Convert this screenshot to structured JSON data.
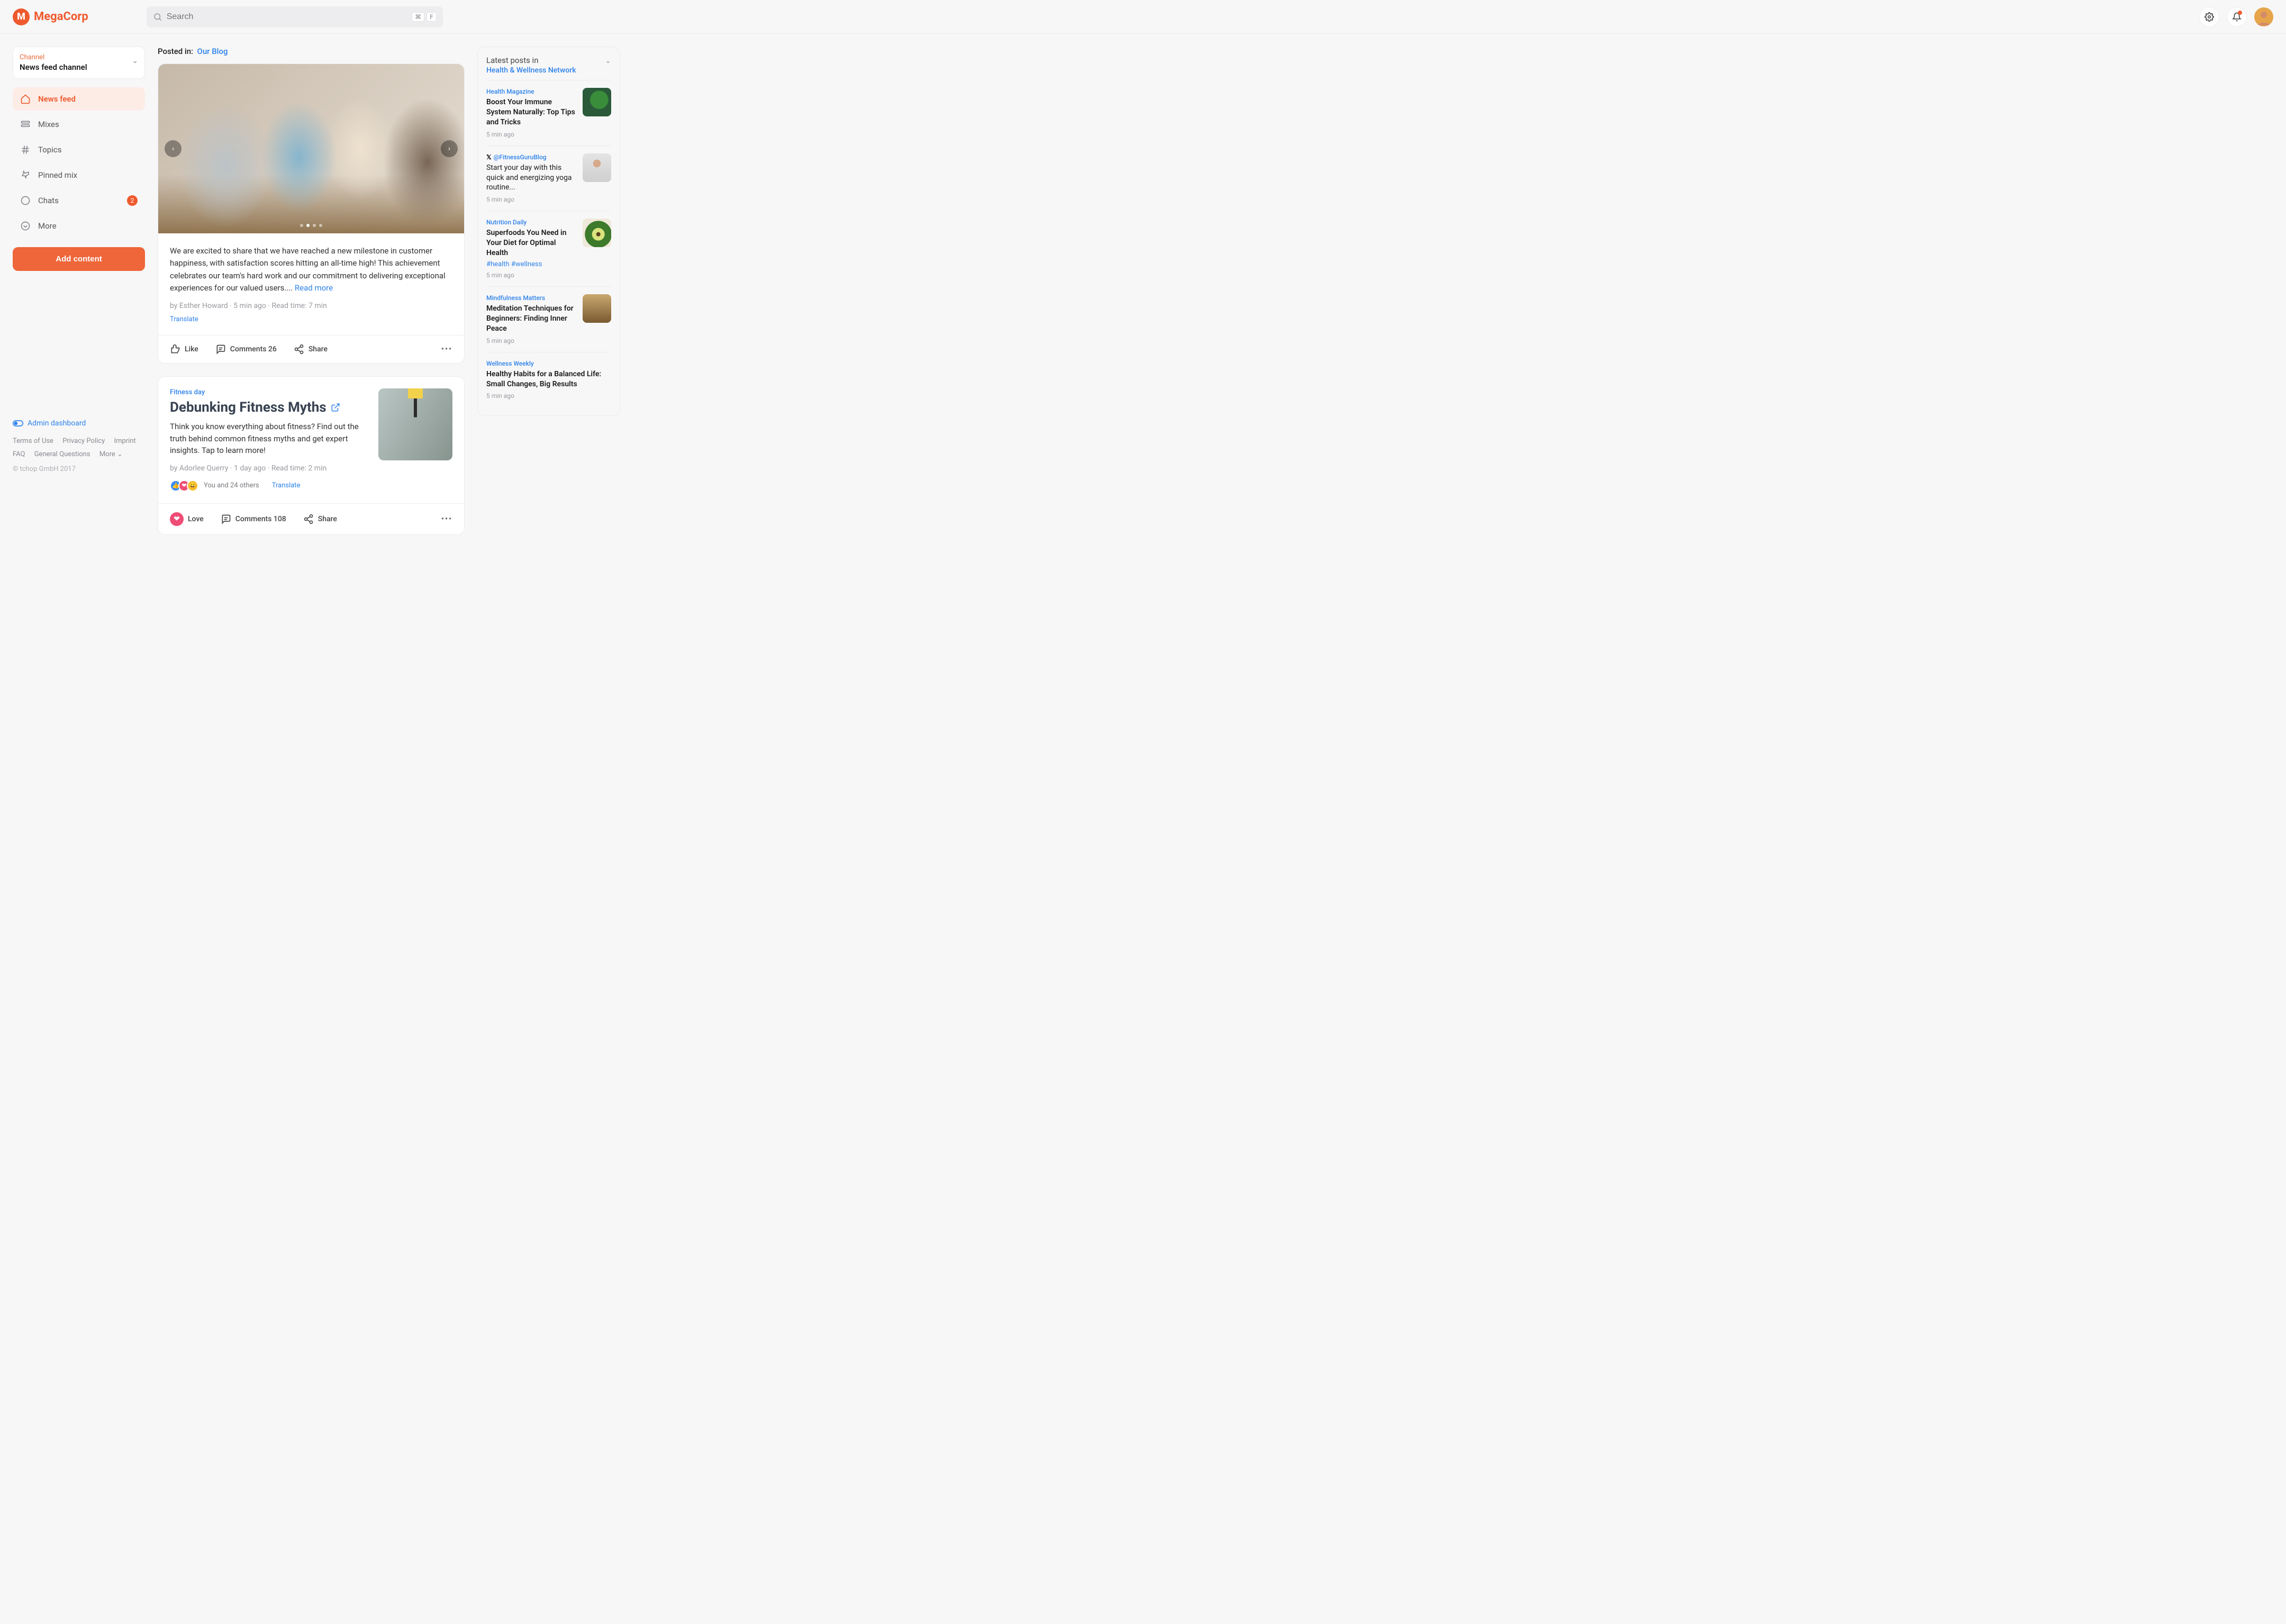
{
  "brand": "MegaCorp",
  "search": {
    "placeholder": "Search",
    "kbd1": "⌘",
    "kbd2": "F"
  },
  "sidebar": {
    "channel_label": "Channel",
    "channel_value": "News feed channel",
    "items": [
      {
        "label": "News feed"
      },
      {
        "label": "Mixes"
      },
      {
        "label": "Topics"
      },
      {
        "label": "Pinned mix"
      },
      {
        "label": "Chats",
        "badge": "2"
      },
      {
        "label": "More"
      }
    ],
    "add_content": "Add content",
    "admin_link": "Admin dashboard",
    "footer": {
      "terms": "Terms of Use",
      "privacy": "Privacy Policy",
      "imprint": "Imprint",
      "faq": "FAQ",
      "general": "General Questions",
      "more": "More"
    },
    "copyright": "© tchop GmbH 2017"
  },
  "main": {
    "posted_in_label": "Posted in:",
    "posted_in_value": "Our Blog",
    "post1": {
      "excerpt": "We are excited to share that we have reached a new milestone in customer happiness, with satisfaction scores hitting an all-time high! This achievement celebrates our team's hard work and our commitment to delivering exceptional experiences for our valued users....",
      "read_more": "Read more",
      "byline": "by Esther Howard · 5 min ago · Read time: 7 min",
      "translate": "Translate",
      "like": "Like",
      "comments": "Comments 26",
      "share": "Share"
    },
    "post2": {
      "category": "Fitness day",
      "title": "Debunking Fitness Myths",
      "excerpt": "Think you know everything about fitness? Find out the truth behind common fitness myths and get expert insights. Tap to learn more!",
      "byline": "by Adorlee Querry · 1 day ago · Read time: 2 min",
      "reactions_text": "You and 24 others",
      "translate": "Translate",
      "love": "Love",
      "comments": "Comments 108",
      "share": "Share"
    }
  },
  "right": {
    "title": "Latest posts in",
    "link": "Health & Wellness Network",
    "items": [
      {
        "source": "Health Magazine",
        "title": "Boost Your Immune System Naturally: Top Tips and Tricks",
        "time": "5 min ago",
        "thumb": "plant"
      },
      {
        "source": "@FitnessGuruBlog",
        "source_prefix": "x",
        "title": "Start your day with this quick and energizing yoga routine...",
        "time": "5 min ago",
        "thumb": "yoga"
      },
      {
        "source": "Nutrition Daily",
        "title": "Superfoods You Need in Your Diet for Optimal Health",
        "tags": "#health #wellness",
        "time": "5 min ago",
        "thumb": "avocado"
      },
      {
        "source": "Mindfulness Matters",
        "title": "Meditation Techniques for Beginners: Finding Inner Peace",
        "time": "5 min ago",
        "thumb": "bowls"
      },
      {
        "source": "Wellness Weekly",
        "title": "Healthy Habits for a Balanced Life: Small Changes, Big Results",
        "time": "5 min ago"
      }
    ]
  }
}
